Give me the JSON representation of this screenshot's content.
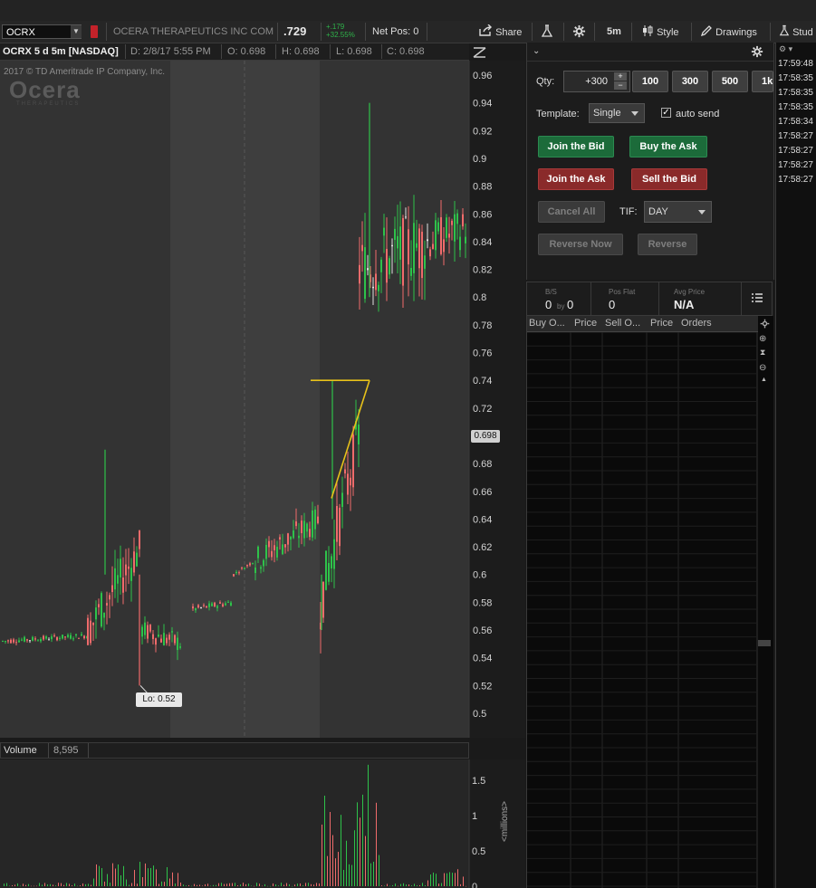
{
  "topbar": {},
  "toolbar": {
    "symbol": "OCRX",
    "company": "OCERA THERAPEUTICS INC COM",
    "last_price": ".729",
    "change_abs": "+.179",
    "change_pct": "+32.55%",
    "net_pos": "Net Pos: 0",
    "share": "Share",
    "timeframe": "5m",
    "style": "Style",
    "drawings": "Drawings",
    "studies": "Stud"
  },
  "chart_header": {
    "title": "OCRX 5 d 5m [NASDAQ]",
    "date": "D:  2/8/17 5:55 PM",
    "open": "O:  0.698",
    "high": "H:  0.698",
    "low": "L:  0.698",
    "close": "C:  0.698",
    "copyright": "2017 © TD Ameritrade IP Company, Inc.",
    "watermark": "Ocera",
    "watermark_sub": "THERAPEUTICS"
  },
  "chart_data": {
    "type": "candlestick",
    "y_ticks": [
      "0.96",
      "0.94",
      "0.92",
      "0.9",
      "0.88",
      "0.86",
      "0.84",
      "0.82",
      "0.8",
      "0.78",
      "0.76",
      "0.74",
      "0.72",
      "0.7",
      "0.68",
      "0.66",
      "0.64",
      "0.62",
      "0.6",
      "0.58",
      "0.56",
      "0.54",
      "0.52",
      "0.5"
    ],
    "ylim": [
      0.49,
      0.97
    ],
    "current_price_label": "0.698",
    "low_label": "Lo: 0.52",
    "volume_label": "Volume",
    "volume_value": "8,595",
    "volume_ticks": [
      "1.5",
      "1",
      "0.5",
      "0"
    ],
    "volume_unit": "<millions>",
    "colors": {
      "up": "#2ec24a",
      "down": "#f06b6b",
      "flat": "#e0e0e0",
      "drawing": "#e8c21a",
      "session_light": "#3e3e3e",
      "session_dark": "#303030"
    }
  },
  "active_trader": {
    "qty_label": "Qty:",
    "qty_value": "+300",
    "qty_presets": [
      "100",
      "300",
      "500",
      "1k"
    ],
    "template_label": "Template:",
    "template_value": "Single",
    "auto_send": "auto send",
    "join_bid": "Join the Bid",
    "buy_ask": "Buy the Ask",
    "join_ask": "Join the Ask",
    "sell_bid": "Sell the Bid",
    "cancel_all": "Cancel All",
    "tif_label": "TIF:",
    "tif_value": "DAY",
    "reverse_now": "Reverse Now",
    "reverse": "Reverse"
  },
  "summary": {
    "bs_label": "B/S",
    "bs_value_a": "0",
    "bs_by": "by",
    "bs_value_b": "0",
    "pos_flat_label": "Pos Flat",
    "pos_flat_value": "0",
    "avg_price_label": "Avg Price",
    "avg_price_value": "N/A"
  },
  "ladder": {
    "columns": [
      "Buy O...",
      "Price",
      "Sell O...",
      "Price",
      "Orders"
    ]
  },
  "time_sales": {
    "rows": [
      "17:59:48",
      "17:58:35",
      "17:58:35",
      "17:58:35",
      "17:58:34",
      "17:58:27",
      "17:58:27",
      "17:58:27",
      "17:58:27"
    ]
  }
}
